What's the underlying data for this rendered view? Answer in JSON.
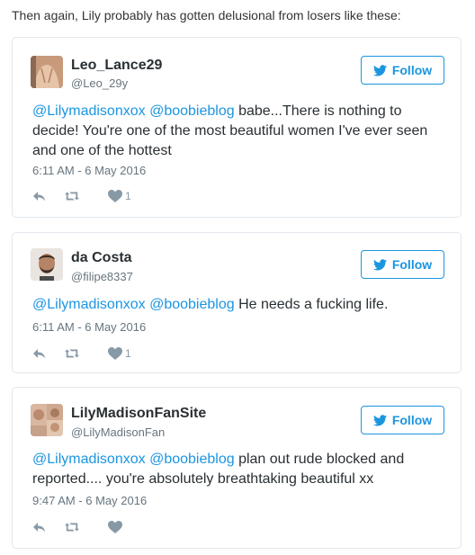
{
  "intro_text": "Then again, Lily probably has gotten delusional from losers like these:",
  "follow_label": "Follow",
  "colors": {
    "link": "#1b95e0",
    "muted": "#66757f",
    "border": "#e1e8ed"
  },
  "tweets": [
    {
      "name": "Leo_Lance29",
      "handle": "@Leo_29y",
      "mention1": "@Lilymadisonxox",
      "mention2": "@boobieblog",
      "body": " babe...There is nothing to decide! You're one of the most beautiful women I've ever seen and one of the hottest",
      "time": "6:11 AM - 6 May 2016",
      "likes": "1"
    },
    {
      "name": "da Costa",
      "handle": "@filipe8337",
      "mention1": "@Lilymadisonxox",
      "mention2": "@boobieblog",
      "body": " He needs a fucking life.",
      "time": "6:11 AM - 6 May 2016",
      "likes": "1"
    },
    {
      "name": "LilyMadisonFanSite",
      "handle": "@LilyMadisonFan",
      "mention1": "@Lilymadisonxox",
      "mention2": "@boobieblog",
      "body": " plan out rude blocked and reported.... you're absolutely breathtaking beautiful xx",
      "time": "9:47 AM - 6 May 2016",
      "likes": ""
    }
  ]
}
